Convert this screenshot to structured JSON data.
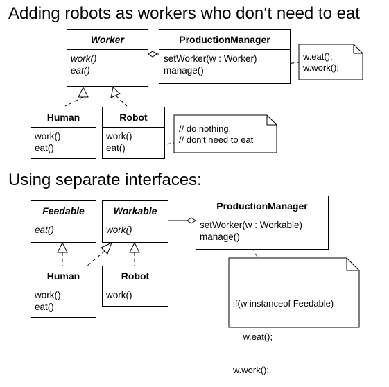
{
  "top": {
    "heading": "Adding robots as workers who don‘t need to eat",
    "worker": {
      "name": "Worker",
      "methods": [
        "work()",
        "eat()"
      ]
    },
    "production_manager": {
      "name": "ProductionManager",
      "methods": [
        "setWorker(w :  Worker)",
        "manage()"
      ]
    },
    "human": {
      "name": "Human",
      "methods": [
        "work()",
        "eat()"
      ]
    },
    "robot": {
      "name": "Robot",
      "methods": [
        "work()",
        "eat()"
      ]
    },
    "note_manage": [
      "w.eat();",
      "w.work();"
    ],
    "note_robot_eat": [
      "// do nothing,",
      "// don't need to eat"
    ]
  },
  "bottom": {
    "heading": "Using separate interfaces:",
    "feedable": {
      "name": "Feedable",
      "methods": [
        "eat()"
      ]
    },
    "workable": {
      "name": "Workable",
      "methods": [
        "work()"
      ]
    },
    "production_manager": {
      "name": "ProductionManager",
      "methods": [
        "setWorker(w :  Workable)",
        "manage()"
      ]
    },
    "human": {
      "name": "Human",
      "methods": [
        "work()",
        "eat()"
      ]
    },
    "robot": {
      "name": "Robot",
      "methods": [
        "work()"
      ]
    },
    "note_manage": [
      "if(w instanceof Feedable)",
      "    w.eat();",
      "w.work();"
    ]
  }
}
